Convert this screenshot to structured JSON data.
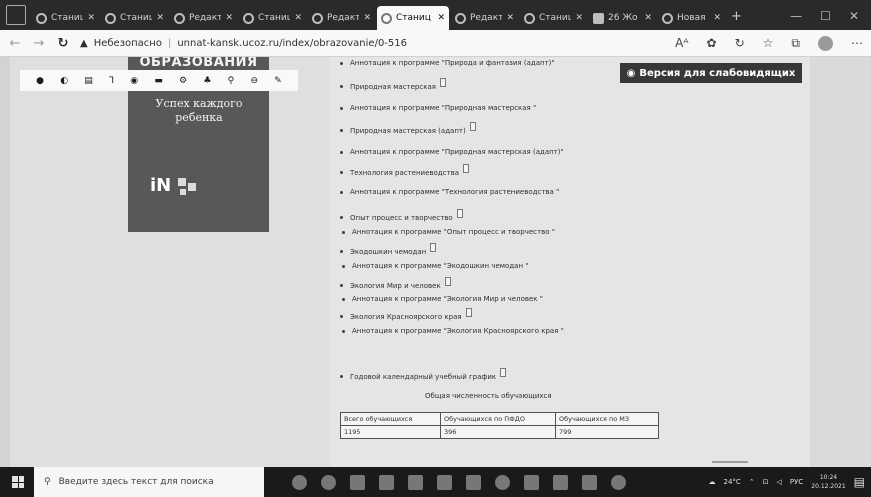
{
  "browser": {
    "tabs": [
      {
        "label": "Станица",
        "active": false
      },
      {
        "label": "Станица",
        "active": false
      },
      {
        "label": "Редакт",
        "active": false
      },
      {
        "label": "Станица",
        "active": false
      },
      {
        "label": "Редакт",
        "active": false
      },
      {
        "label": "Станиц",
        "active": true
      },
      {
        "label": "Редакт",
        "active": false
      },
      {
        "label": "Станица",
        "active": false
      },
      {
        "label": "26 Жо",
        "active": false
      },
      {
        "label": "Новая",
        "active": false
      }
    ],
    "security_label": "Небезопасно",
    "url": "unnat-kansk.ucoz.ru/index/obrazovanie/0-516"
  },
  "sidebar": {
    "heading": "ОБРАЗОВАНИЯ",
    "banner_title": "Успех каждого ребенка",
    "logo_text": "iN"
  },
  "accessibility_button": "Версия для слабовидящих",
  "documents": [
    {
      "text": "Аннотация к программе \"Природа и фантазия (адапт)\"",
      "icon": false
    },
    {
      "text": "Природная мастерская",
      "icon": true
    },
    {
      "text": "Аннотация к программе \"Природная мастерская \"",
      "icon": false
    },
    {
      "text": "Природная мастерская (адапт)",
      "icon": true
    },
    {
      "text": "Аннотация к программе \"Природная мастерская (адапт)\"",
      "icon": false
    },
    {
      "text": "Технология растениеводства",
      "icon": true
    },
    {
      "text": "Аннотация к программе \"Технология растениеводства \"",
      "icon": false
    },
    {
      "text": "Опыт процесс и творчество",
      "icon": true
    },
    {
      "text": "Аннотация к программе \"Опыт процесс и творчество \"",
      "icon": false
    },
    {
      "text": "Экодошкин чемодан",
      "icon": true
    },
    {
      "text": "Аннотация к программе \"Экодошкин чемодан \"",
      "icon": false
    },
    {
      "text": "Экология Мир и человек",
      "icon": true
    },
    {
      "text": "Аннотация к программе \"Экология Мир и человек \"",
      "icon": false
    },
    {
      "text": "Экология Красноярского края",
      "icon": true
    },
    {
      "text": "Аннотация к программе \"Экология Красноярского края \"",
      "icon": false
    },
    {
      "text": "Годовой календарный учебный график",
      "icon": true
    }
  ],
  "stats": {
    "title": "Общая численность обучающихся",
    "headers": [
      "Всего обучающихся",
      "Обучающихся по ПФДО",
      "Обучающихся по МЗ"
    ],
    "values": [
      "1195",
      "396",
      "799"
    ]
  },
  "taskbar": {
    "search_placeholder": "Введите здесь текст для поиска",
    "temperature": "24°C",
    "language": "РУС",
    "time": "10:24",
    "date": "20.12.2021"
  }
}
